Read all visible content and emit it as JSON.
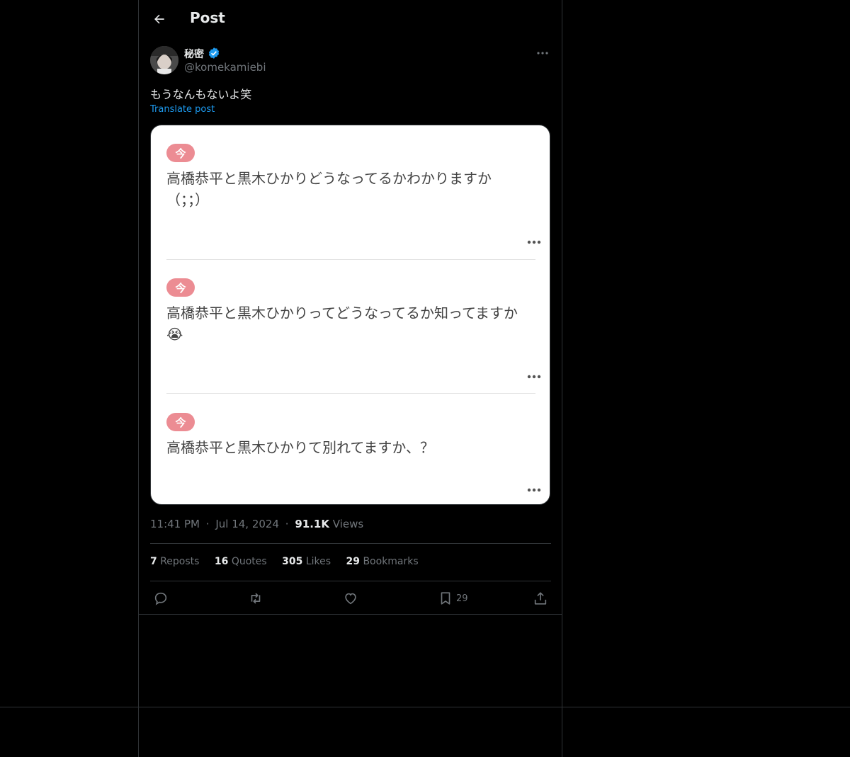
{
  "header": {
    "title": "Post"
  },
  "author": {
    "display_name": "秘密",
    "handle": "@komekamiebi",
    "verified": true
  },
  "post": {
    "text": "もうなんもないよ笑",
    "translate_label": "Translate post",
    "image_cards": [
      {
        "badge": "今",
        "text": "高橋恭平と黒木ひかりどうなってるかわかりますか（；；）"
      },
      {
        "badge": "今",
        "text": "高橋恭平と黒木ひかりってどうなってるか知ってますか😭"
      },
      {
        "badge": "今",
        "text": "高橋恭平と黒木ひかりて別れてますか、？"
      }
    ]
  },
  "meta": {
    "time": "11:41 PM",
    "separator": "·",
    "date": "Jul 14, 2024",
    "views_count": "91.1K",
    "views_label": "Views"
  },
  "stats": {
    "reposts_count": "7",
    "reposts_label": "Reposts",
    "quotes_count": "16",
    "quotes_label": "Quotes",
    "likes_count": "305",
    "likes_label": "Likes",
    "bookmarks_count": "29",
    "bookmarks_label": "Bookmarks"
  },
  "actions": {
    "bookmark_count": "29"
  },
  "colors": {
    "background": "#000000",
    "accent": "#1d9bf0",
    "badge": "#ec8c93",
    "muted": "#71767b",
    "text": "#e7e9ea"
  },
  "icons": [
    "back-arrow-icon",
    "verified-badge-icon",
    "more-icon",
    "reply-icon",
    "repost-icon",
    "like-icon",
    "bookmark-icon",
    "share-icon"
  ]
}
